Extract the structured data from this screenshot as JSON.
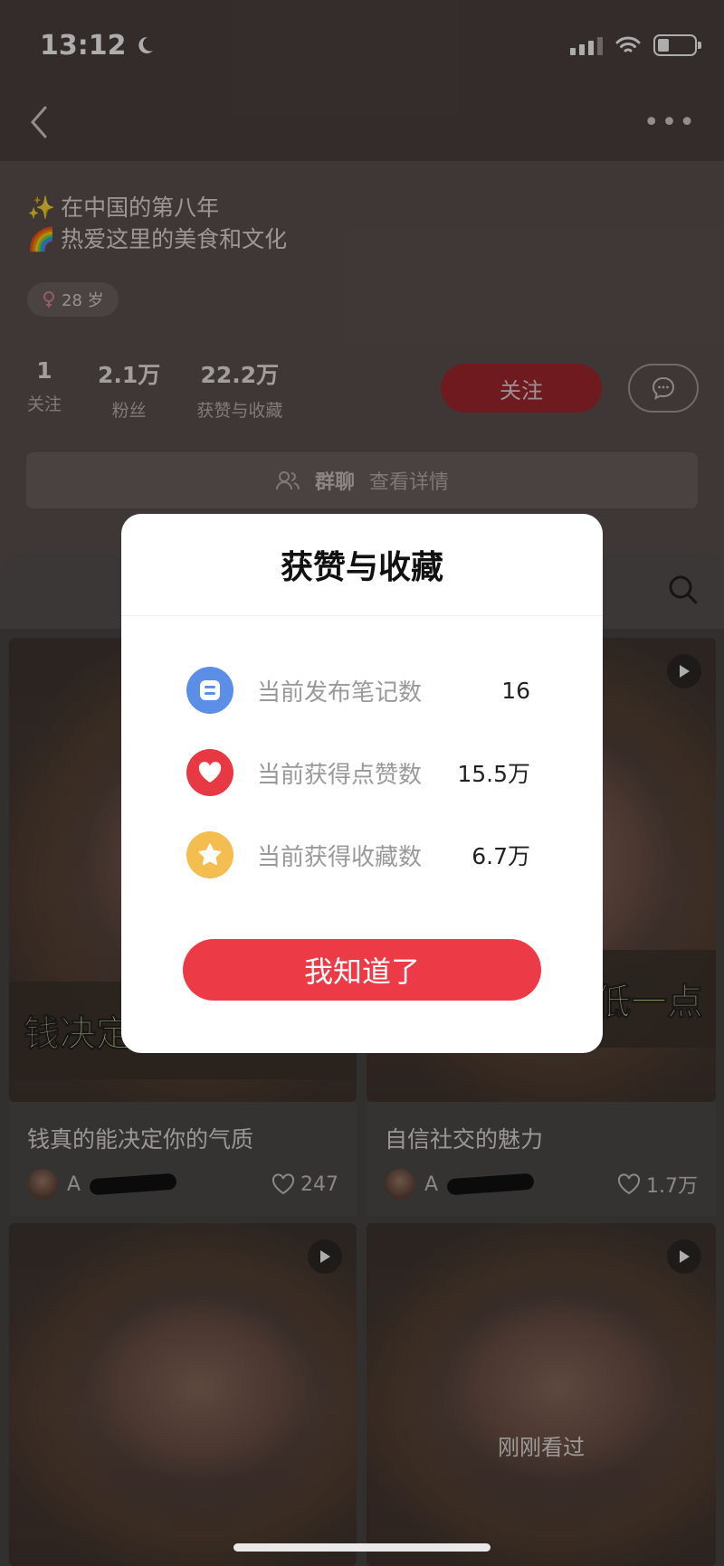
{
  "status": {
    "time": "13:12"
  },
  "profile": {
    "bio_line1": "在中国的第八年",
    "bio_line2": "热爱这里的美食和文化",
    "bio_emoji1": "✨",
    "bio_emoji2": "🌈",
    "age_badge": "28 岁",
    "stats": [
      {
        "num": "1",
        "label": "关注"
      },
      {
        "num": "2.1万",
        "label": "粉丝"
      },
      {
        "num": "22.2万",
        "label": "获赞与收藏"
      }
    ],
    "follow_label": "关注",
    "group_label": "群聊",
    "group_detail": "查看详情"
  },
  "cards": [
    {
      "caption": "钱决定",
      "title": "钱真的能决定你的气质",
      "author": "A",
      "likes": "247"
    },
    {
      "caption": "低一点",
      "title": "自信社交的魅力",
      "author": "A",
      "likes": "1.7万"
    },
    {
      "caption": "",
      "title": "",
      "author": "",
      "likes": ""
    },
    {
      "caption": "",
      "title": "",
      "author": "",
      "likes": "",
      "seen_label": "刚刚看过"
    }
  ],
  "modal": {
    "title": "获赞与收藏",
    "rows": [
      {
        "icon": "notes-icon",
        "color": "#5b8ee6",
        "label": "当前发布笔记数",
        "value": "16"
      },
      {
        "icon": "heart-icon",
        "color": "#e83843",
        "label": "当前获得点赞数",
        "value": "15.5万"
      },
      {
        "icon": "star-icon",
        "color": "#f3bd4f",
        "label": "当前获得收藏数",
        "value": "6.7万"
      }
    ],
    "ok_label": "我知道了"
  },
  "colors": {
    "accent": "#ec3b47",
    "follow_dim": "#a2272f"
  }
}
